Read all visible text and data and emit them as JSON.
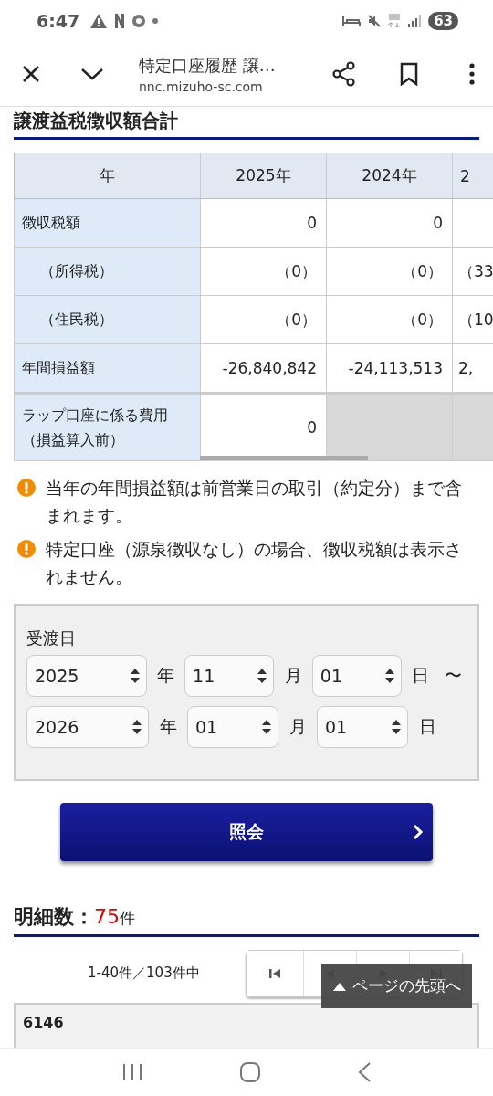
{
  "status_bar": {
    "time": "6:47",
    "battery": "63"
  },
  "toolbar": {
    "title": "特定口座履歴 譲…",
    "url": "nnc.mizuho-sc.com"
  },
  "section_title": "譲渡益税徴収額合計",
  "table": {
    "columns": [
      "年",
      "2025年",
      "2024年",
      "2"
    ],
    "rows": [
      {
        "label": "徴収税額",
        "kind": "main",
        "values": [
          "0",
          "0"
        ]
      },
      {
        "label": "（所得税）",
        "kind": "sub",
        "values": [
          "（0）",
          "（0）",
          "（33"
        ]
      },
      {
        "label": "（住民税）",
        "kind": "sub",
        "values": [
          "（0）",
          "（0）",
          "（10"
        ]
      },
      {
        "label": "年間損益額",
        "kind": "main",
        "values": [
          "-26,840,842",
          "-24,113,513",
          "2,"
        ]
      },
      {
        "label": "ラップ口座に係る費用（損益算入前）",
        "kind": "fee",
        "values": [
          "0"
        ]
      }
    ]
  },
  "notes": [
    "当年の年間損益額は前営業日の取引（約定分）まで含まれます。",
    "特定口座（源泉徴収なし）の場合、徴収税額は表示されません。"
  ],
  "date_form": {
    "label": "受渡日",
    "rows": [
      {
        "fields": [
          {
            "value": "2025",
            "unit": "年"
          },
          {
            "value": "11",
            "unit": "月"
          },
          {
            "value": "01",
            "unit": "日"
          }
        ],
        "suffix": "〜"
      },
      {
        "fields": [
          {
            "value": "2026",
            "unit": "年"
          },
          {
            "value": "01",
            "unit": "月"
          },
          {
            "value": "01",
            "unit": "日"
          }
        ]
      }
    ]
  },
  "submit_button": "照会",
  "count": {
    "label": "明細数：",
    "number": "75",
    "unit": "件"
  },
  "pager": {
    "range": "1-40件／103件中"
  },
  "back_to_top": "ページの先頭へ",
  "card": {
    "code": "6146"
  }
}
